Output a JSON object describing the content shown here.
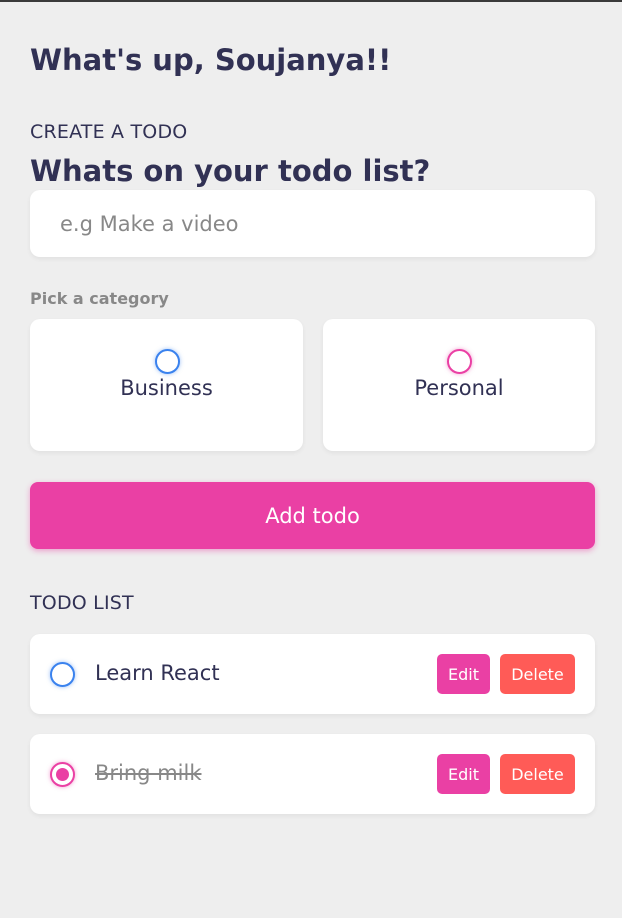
{
  "greeting": {
    "text": "What's up, Soujanya!!"
  },
  "create": {
    "label": "CREATE A TODO",
    "question": "Whats on your todo list?",
    "input_placeholder": "e.g Make a video",
    "input_value": "",
    "category_label": "Pick a category",
    "categories": [
      {
        "label": "Business",
        "color": "#3a82ee"
      },
      {
        "label": "Personal",
        "color": "#ea40a4"
      }
    ],
    "add_button": "Add todo"
  },
  "list": {
    "label": "TODO LIST",
    "items": [
      {
        "text": "Learn React",
        "category": "Business",
        "done": false,
        "edit_label": "Edit",
        "delete_label": "Delete"
      },
      {
        "text": "Bring milk",
        "category": "Personal",
        "done": true,
        "edit_label": "Edit",
        "delete_label": "Delete"
      }
    ]
  },
  "colors": {
    "background": "#eeeeee",
    "text": "#313154",
    "muted": "#888888",
    "accent": "#ea40a4",
    "business": "#3a82ee",
    "danger": "#ff5b57"
  }
}
